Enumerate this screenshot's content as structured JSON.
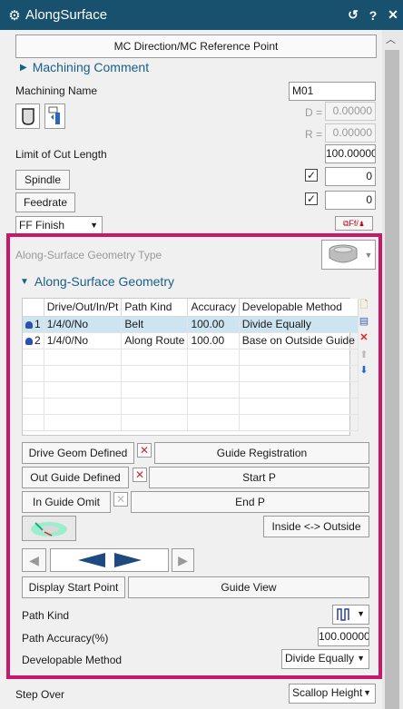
{
  "window": {
    "title": "AlongSurface",
    "refresh_icon": "refresh-icon",
    "help_label": "?",
    "close_label": "✕"
  },
  "top": {
    "mc_direction_button": "MC Direction/MC Reference Point",
    "machining_comment": "Machining Comment",
    "machining_name_label": "Machining Name",
    "machining_name_value": "M01",
    "d_label": "D =",
    "d_value": "0.00000",
    "r_label": "R =",
    "r_value": "0.00000",
    "limit_label": "Limit of Cut Length",
    "limit_value": "100.00000",
    "spindle_label": "Spindle",
    "spindle_value": "0",
    "spindle_checked": "✓",
    "feedrate_label": "Feedrate",
    "feedrate_value": "0",
    "feedrate_checked": "✓",
    "finish_select": "FF Finish",
    "ff_button": "⧉Ff/♟"
  },
  "geometry": {
    "type_label": "Along-Surface Geometry Type",
    "section_title": "Along-Surface Geometry",
    "columns": [
      "",
      "Drive/Out/In/Pt",
      "Path Kind",
      "Accuracy",
      "Developable Method"
    ],
    "rows": [
      {
        "num": "1",
        "drive": "1/4/0/No",
        "path_kind": "Belt",
        "accuracy": "100.00",
        "method": "Divide Equally"
      },
      {
        "num": "2",
        "drive": "1/4/0/No",
        "path_kind": "Along Route",
        "accuracy": "100.00",
        "method": "Base on Outside Guide"
      }
    ],
    "drive_geom_button": "Drive Geom Defined",
    "guide_registration_button": "Guide Registration",
    "out_guide_button": "Out Guide  Defined",
    "start_p_button": "Start P",
    "in_guide_button": "In Guide  Omit",
    "end_p_button": "End P",
    "inside_outside_button": "Inside <-> Outside",
    "display_start_button": "Display Start Point",
    "guide_view_button": "Guide View",
    "path_kind_label": "Path Kind",
    "path_accuracy_label": "Path Accuracy(%)",
    "path_accuracy_value": "100.00000",
    "developable_label": "Developable Method",
    "developable_value": "Divide Equally"
  },
  "bottom": {
    "step_over_label": "Step Over",
    "step_over_value": "Scallop Height"
  },
  "colors": {
    "title_bg": "#17516e",
    "highlight_border": "#c8186a",
    "selected_row": "#cde4f1",
    "accent_blue": "#1a5e8a"
  }
}
